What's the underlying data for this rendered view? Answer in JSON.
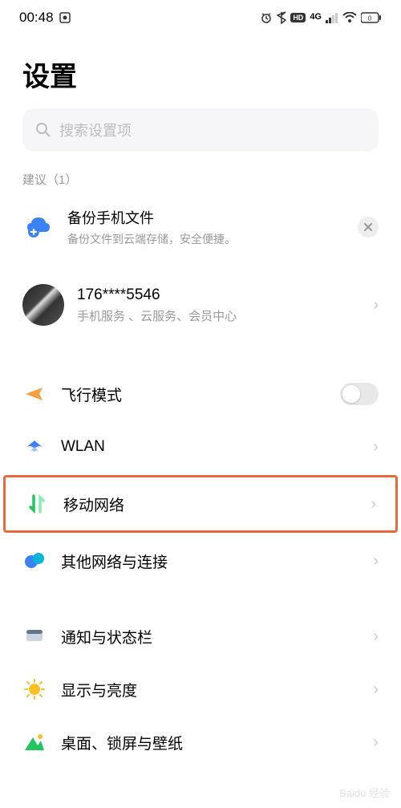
{
  "status": {
    "time": "00:48",
    "network_badge": "HD",
    "signal": "4G"
  },
  "page_title": "设置",
  "search": {
    "placeholder": "搜索设置项"
  },
  "suggestion": {
    "header": "建议（1）",
    "title": "备份手机文件",
    "subtitle": "备份文件到云端存储，安全便捷。"
  },
  "account": {
    "phone": "176****5546",
    "subtitle": "手机服务 、云服务、会员中心"
  },
  "settings": {
    "airplane": "飞行模式",
    "wlan": "WLAN",
    "mobile_network": "移动网络",
    "other_connections": "其他网络与连接",
    "notification": "通知与状态栏",
    "display": "显示与亮度",
    "wallpaper": "桌面、锁屏与壁纸"
  },
  "watermark": "Baidu 经验"
}
